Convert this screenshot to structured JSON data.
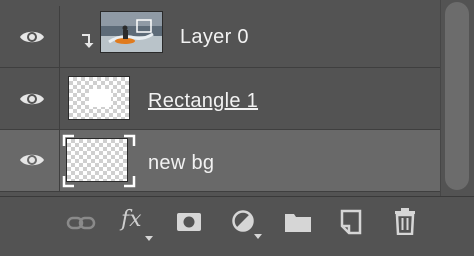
{
  "layers": [
    {
      "name": "Layer 0",
      "visible": true,
      "clipped": true,
      "thumbnail": "photo-thumbnail",
      "underlined": false,
      "selected": false
    },
    {
      "name": "Rectangle 1",
      "visible": true,
      "clipped": false,
      "thumbnail": "white-rectangle-on-transparent",
      "underlined": true,
      "selected": false
    },
    {
      "name": "new bg",
      "visible": true,
      "clipped": false,
      "thumbnail": "transparent",
      "underlined": false,
      "selected": true
    }
  ],
  "toolbar": {
    "fx_label": "fx",
    "icons": [
      "link-layers-icon",
      "fx-icon",
      "add-mask-icon",
      "adjustment-layer-icon",
      "group-folder-icon",
      "new-layer-icon",
      "trash-icon"
    ]
  },
  "colors": {
    "panel_bg": "#535353",
    "selected_row_bg": "#696969",
    "divider": "#3f3f3f",
    "text": "#f2f2f2",
    "icon": "#d6d6d6"
  }
}
